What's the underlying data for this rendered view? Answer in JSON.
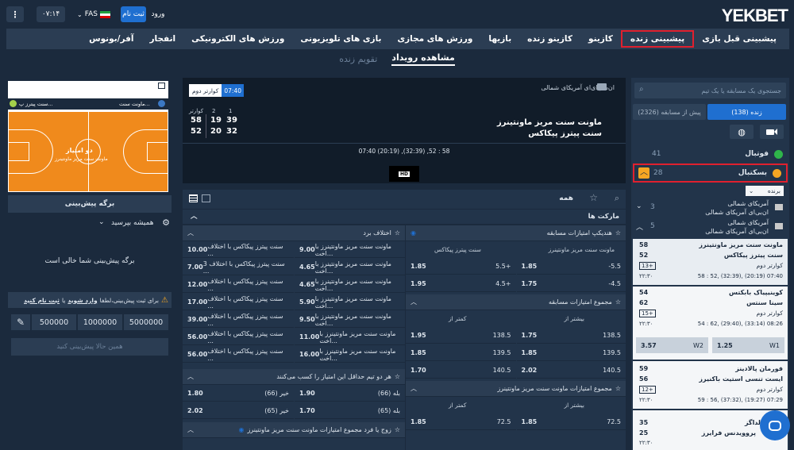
{
  "topbar": {
    "logo": "YEKBET",
    "login": "ورود",
    "register": "ثبت نام",
    "currency": "FAS",
    "time": "۰۷:۱۴",
    "menu_icon": "dots-vertical-icon"
  },
  "nav": [
    "پیشبینی قبل بازی",
    "پیشبینی زنده",
    "کازینو",
    "کازینو زنده",
    "بازیها",
    "ورزش های مجازی",
    "بازی های تلویزیونی",
    "ورزش های الکترونیکی",
    "انفجار",
    "آفر/بونوس"
  ],
  "subnav": {
    "events": "مشاهده رویداد",
    "calendar": "تقویم زنده"
  },
  "sidebar": {
    "search_placeholder": "جستجوی یک مسابقه یا یک تیم",
    "tab_live": "زنده (138)",
    "tab_pre": "پیش از مسابقه (2326)",
    "football": "فوتبال",
    "football_count": "41",
    "basketball": "بسکتبال",
    "basketball_count": "28",
    "winner": "برنده",
    "league1_title": "آمریکای شمالی",
    "league1_sub": "ان‌بی‌ای آمریکای شمالی",
    "league1_count": "3",
    "league2_title": "آمریکای شمالی",
    "league2_sub": "ان‌بی‌ای آمریکای شمالی",
    "league2_count": "5",
    "games": [
      {
        "t1": "ماونت سنت مریز ماونتینرز",
        "s1": "58",
        "t2": "سنت پیترز پیکاکس",
        "s2": "52",
        "extra": "13+",
        "status": "کوارتر دوم",
        "time": "۲۲:۳۰",
        "detail": "58 : 52, (32:39), (20:19) 07:40"
      },
      {
        "t1": "کوینیپیاک بابکتس",
        "s1": "54",
        "t2": "سینا سنتس",
        "s2": "62",
        "extra": "15+",
        "status": "کوارتر دوم",
        "time": "۲۲:۳۰",
        "detail": "54 : 62, (29:40), (33:14) 08:26",
        "w1": "W1",
        "w1v": "1.25",
        "w2": "W2",
        "w2v": "3.57"
      },
      {
        "t1": "فورمان پالادینز",
        "s1": "59",
        "t2": "ایست تنسی استیت باکنیرز",
        "s2": "56",
        "extra": "12+",
        "status": "کوارتر دوم",
        "time": "۲۲:۳۰",
        "detail": "59 : 56, (37:32), (19:27) 07:29"
      },
      {
        "t1": "باتلر بولداگز",
        "s1": "35",
        "t2": "پروویدنس فرایرز",
        "s2": "25",
        "time": "۲۲:۳۰"
      }
    ]
  },
  "match": {
    "league": "ان‌سی‌ای‌ای آمریکای شمالی",
    "period": "کوارتر دوم",
    "clock": "07:40",
    "team1": "ماونت سنت مریز ماونتینرز",
    "team2": "سنت پیترز پیکاکس",
    "hdr_q": "کوارتر",
    "hdr_2": "2",
    "hdr_1": "1",
    "t1_total": "58",
    "t1_q2": "19",
    "t1_q1": "39",
    "t2_total": "52",
    "t2_q2": "20",
    "t2_q1": "32",
    "detail": "07:40 (20:19) ,(32:39) ,52 : 58",
    "hd": "HD"
  },
  "markets": {
    "filter_all": "همه",
    "header": "مارکت ها",
    "handicap": {
      "title": "هندیکپ امتیازات مسابقه",
      "col1": "ماونت سنت مریز ماونتینرز",
      "col2": "سنت پیترز پیکاکس",
      "rows": [
        [
          "-5.5",
          "1.85",
          "5.5+",
          "1.85"
        ],
        [
          "-4.5",
          "1.75",
          "4.5+",
          "1.95"
        ]
      ]
    },
    "total": {
      "title": "مجموع امتیازات مسابقه",
      "col1": "بیشتر از",
      "col2": "کمتر از",
      "rows": [
        [
          "138.5",
          "1.75",
          "138.5",
          "1.95"
        ],
        [
          "139.5",
          "1.85",
          "139.5",
          "1.85"
        ],
        [
          "140.5",
          "2.02",
          "140.5",
          "1.70"
        ]
      ]
    },
    "total_team": {
      "title": "مجموع امتیازات ماونت سنت مریز ماونتینرز",
      "col1": "بیشتر از",
      "col2": "کمتر از",
      "rows": [
        [
          "72.5",
          "1.85",
          "72.5",
          "1.85"
        ]
      ]
    },
    "diff": {
      "title": "اختلاف برد",
      "rows": [
        [
          "ماونت سنت مریز ماونتینرز با اخت...",
          "9.00",
          "سنت پیترز پیکاکس با اختلاف ...",
          "10.00"
        ],
        [
          "ماونت سنت مریز ماونتینرز با اخت...",
          "4.65",
          "سنت پیترز پیکاکس با اختلاف 3 ...",
          "7.00"
        ],
        [
          "ماونت سنت مریز ماونتینرز با اخت...",
          "4.65",
          "سنت پیترز پیکاکس با اختلاف ...",
          "12.00"
        ],
        [
          "ماونت سنت مریز ماونتینرز با اخت...",
          "5.90",
          "سنت پیترز پیکاکس با اختلاف ...",
          "17.00"
        ],
        [
          "ماونت سنت مریز ماونتینرز با اخت...",
          "9.50",
          "سنت پیترز پیکاکس با اختلاف ...",
          "39.00"
        ],
        [
          "ماونت سنت مریز ماونتینرز با اخت...",
          "11.00",
          "سنت پیترز پیکاکس با اختلاف ...",
          "56.00"
        ],
        [
          "ماونت سنت مریز ماونتینرز با اخت...",
          "16.00",
          "سنت پیترز پیکاکس با اختلاف ...",
          "56.00"
        ]
      ]
    },
    "both": {
      "title": "هر دو تیم حداقل این امتیاز را کسب می‌کنند",
      "rows": [
        [
          "بله (66)",
          "1.90",
          "خیر (66)",
          "1.80"
        ],
        [
          "بله (65)",
          "1.70",
          "خیر (65)",
          "2.02"
        ]
      ]
    },
    "parity": {
      "title": "زوج یا فرد مجموع امتیازات ماونت سنت مریز ماونتینرز"
    }
  },
  "betslip": {
    "mini_team1": "ماونت سنت...",
    "mini_team2": "سنت پیترز پ...",
    "court_label": "دو امتیاز",
    "court_team": "ماونت سنت مریز ماونتینرز",
    "slip_title": "برگه پیش‌بینی",
    "always_ask": "همیشه بپرسید",
    "empty": "برگه پیش‌بینی شما خالی است",
    "login_notice": "برای ثبت پیش‌بینی،لطفا",
    "login_link": "وارد شوید",
    "or": "یا",
    "register_link": "ثبت نام کنید",
    "amounts": [
      "500000",
      "1000000",
      "5000000"
    ],
    "place_now": "همین حالا پیش‌بینی کنید"
  }
}
